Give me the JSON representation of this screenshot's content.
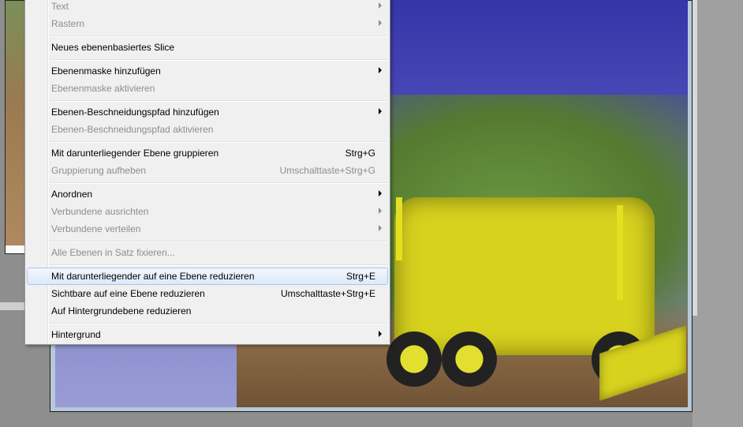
{
  "menu": {
    "items": [
      {
        "label": "Text",
        "shortcut": "",
        "submenu": true,
        "disabled": true
      },
      {
        "label": "Rastern",
        "shortcut": "",
        "submenu": true,
        "disabled": true
      },
      {
        "label": "Neues ebenenbasiertes Slice",
        "shortcut": "",
        "submenu": false,
        "disabled": false
      },
      {
        "label": "Ebenenmaske hinzufügen",
        "shortcut": "",
        "submenu": true,
        "disabled": false
      },
      {
        "label": "Ebenenmaske aktivieren",
        "shortcut": "",
        "submenu": false,
        "disabled": true
      },
      {
        "label": "Ebenen-Beschneidungspfad hinzufügen",
        "shortcut": "",
        "submenu": true,
        "disabled": false
      },
      {
        "label": "Ebenen-Beschneidungspfad aktivieren",
        "shortcut": "",
        "submenu": false,
        "disabled": true
      },
      {
        "label": "Mit darunterliegender Ebene gruppieren",
        "shortcut": "Strg+G",
        "submenu": false,
        "disabled": false
      },
      {
        "label": "Gruppierung aufheben",
        "shortcut": "Umschalttaste+Strg+G",
        "submenu": false,
        "disabled": true
      },
      {
        "label": "Anordnen",
        "shortcut": "",
        "submenu": true,
        "disabled": false
      },
      {
        "label": "Verbundene ausrichten",
        "shortcut": "",
        "submenu": true,
        "disabled": true
      },
      {
        "label": "Verbundene verteilen",
        "shortcut": "",
        "submenu": true,
        "disabled": true
      },
      {
        "label": "Alle Ebenen in Satz fixieren...",
        "shortcut": "",
        "submenu": false,
        "disabled": true
      },
      {
        "label": "Mit darunterliegender auf eine Ebene reduzieren",
        "shortcut": "Strg+E",
        "submenu": false,
        "disabled": false,
        "highlighted": true
      },
      {
        "label": "Sichtbare auf eine Ebene reduzieren",
        "shortcut": "Umschalttaste+Strg+E",
        "submenu": false,
        "disabled": false
      },
      {
        "label": "Auf Hintergrundebene reduzieren",
        "shortcut": "",
        "submenu": false,
        "disabled": false
      },
      {
        "label": "Hintergrund",
        "shortcut": "",
        "submenu": true,
        "disabled": false
      }
    ]
  },
  "colors": {
    "menu_bg": "#f0f0f0",
    "disabled_text": "#8d8d8d",
    "highlight_border": "#a8c8ec"
  },
  "icons": {
    "submenu": "submenu-arrow-icon"
  }
}
